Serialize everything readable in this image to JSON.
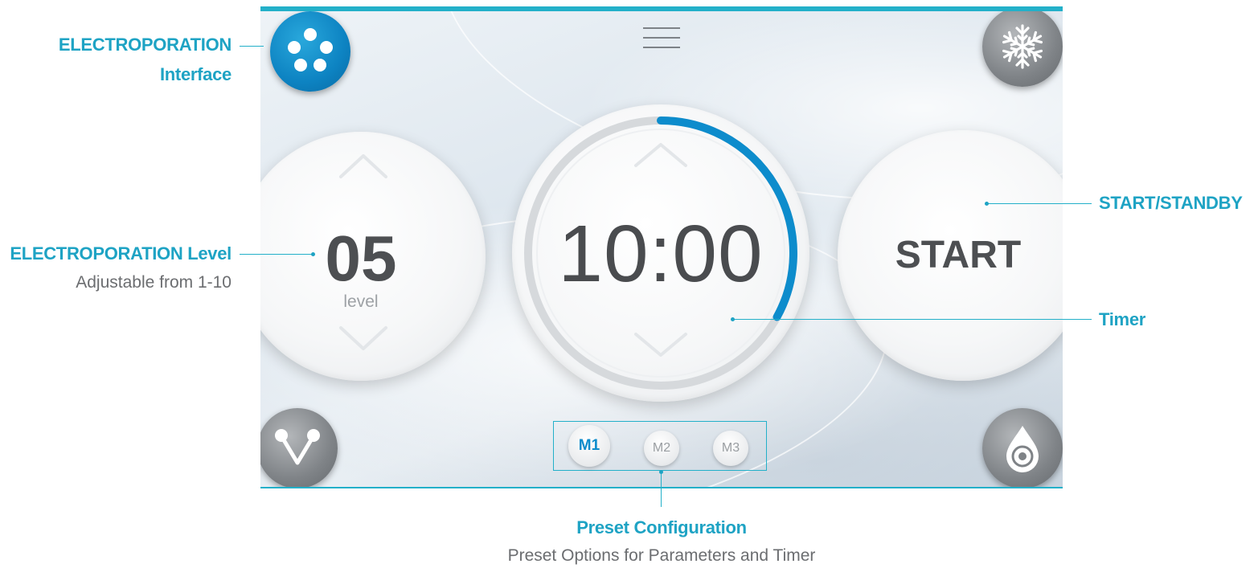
{
  "annotations": {
    "interface": {
      "title_line1": "ELECTROPORATION",
      "title_line2": "Interface"
    },
    "level": {
      "title": "ELECTROPORATION Level",
      "subtitle": "Adjustable from 1-10"
    },
    "start": {
      "title": "START/STANDBY"
    },
    "timer": {
      "title": "Timer"
    },
    "preset": {
      "title": "Preset Configuration",
      "subtitle": "Preset Options for Parameters and Timer"
    }
  },
  "screen": {
    "level": {
      "value": "05",
      "unit": "level"
    },
    "timer": {
      "value": "10:00",
      "progress": 0.33
    },
    "start_label": "START",
    "presets": [
      {
        "label": "M1",
        "active": true
      },
      {
        "label": "M2",
        "active": false
      },
      {
        "label": "M3",
        "active": false
      }
    ],
    "icons": {
      "top_left": "electroporation-dots-icon",
      "top_right": "snowflake-icon",
      "bottom_left": "electrode-v-icon",
      "bottom_right": "water-drop-icon",
      "menu": "hamburger-menu-icon"
    }
  },
  "colors": {
    "accent": "#1ea3c4",
    "progress_arc": "#0d8ccc",
    "text_dark": "#4a4c4f"
  }
}
